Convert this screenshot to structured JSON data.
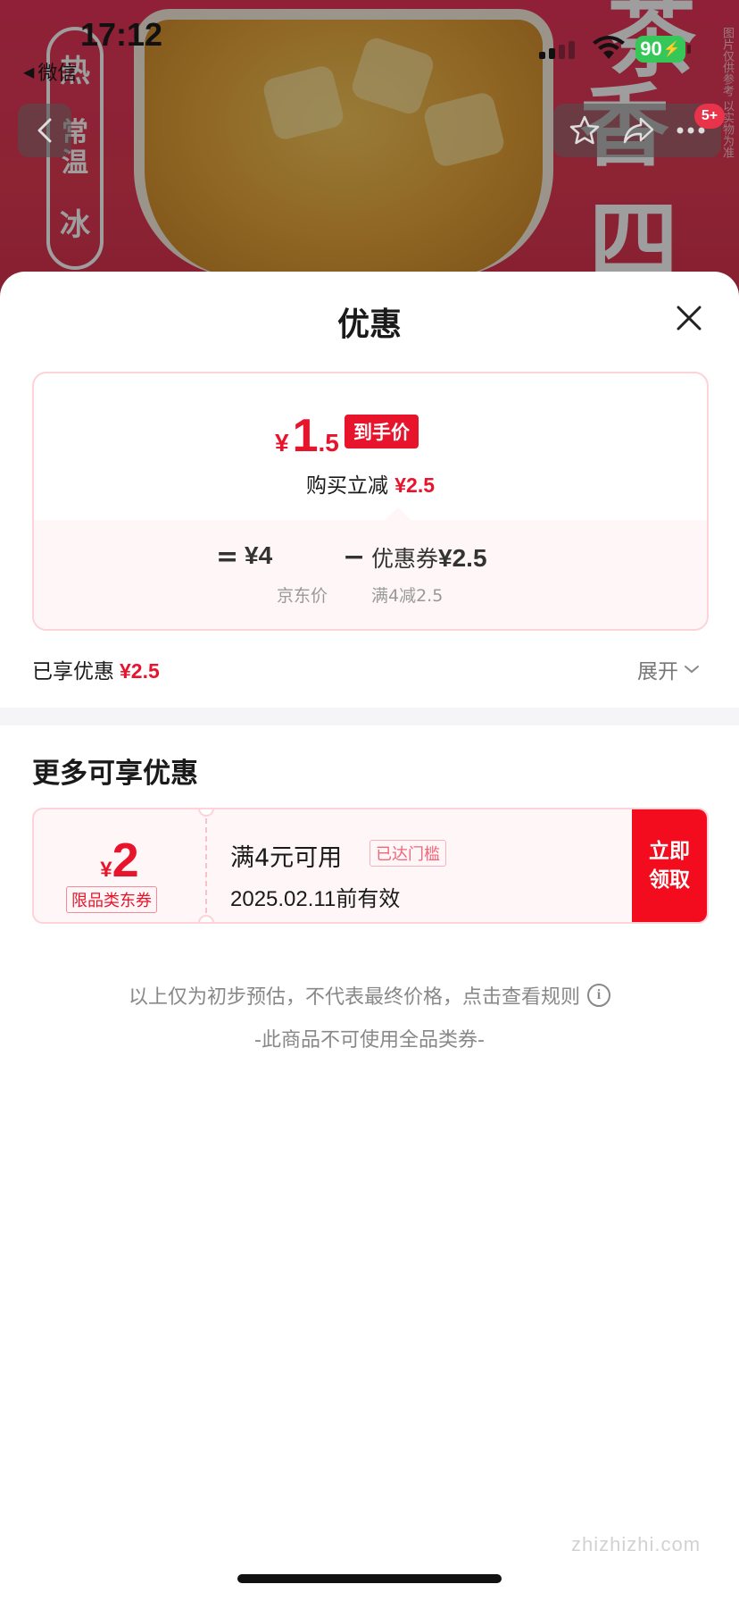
{
  "status_bar": {
    "time": "17:12",
    "back_app": "微信",
    "battery": "90"
  },
  "product_image": {
    "temp_options": [
      "热",
      "常温",
      "冰"
    ],
    "title_chars": [
      "茶",
      "香",
      "四"
    ],
    "side_note": "图片仅供参考 以实物为准"
  },
  "nav": {
    "badge": "5+"
  },
  "sheet": {
    "title": "优惠",
    "final_price": {
      "currency": "¥",
      "integer": "1",
      "decimal": ".5"
    },
    "hand_price_tag": "到手价",
    "instant_cut_label": "购买立减",
    "instant_cut_amount": "¥2.5",
    "formula": {
      "equals": "=",
      "jd_price": "¥4",
      "minus": "−",
      "coupon_label": "优惠券",
      "coupon_amount": "¥2.5",
      "jd_price_label": "京东价",
      "coupon_rule": "满4减2.5"
    },
    "enjoyed_label": "已享优惠",
    "enjoyed_amount": "¥2.5",
    "expand_label": "展开"
  },
  "more_offers": {
    "title": "更多可享优惠",
    "coupon": {
      "currency": "¥",
      "amount": "2",
      "type": "限品类东券",
      "condition": "满4元可用",
      "reached": "已达门槛",
      "valid_date": "2025.02.11",
      "valid_suffix": "前有效",
      "claim_line1": "立即",
      "claim_line2": "领取"
    }
  },
  "notes": {
    "estimate": "以上仅为初步预估，不代表最终价格，点击查看规则",
    "restriction": "-此商品不可使用全品类券-"
  },
  "watermark": "zhizhizhi.com",
  "colors": {
    "accent_red": "#e8142b",
    "claim_red": "#f20c1e",
    "battery_green": "#36c759"
  }
}
